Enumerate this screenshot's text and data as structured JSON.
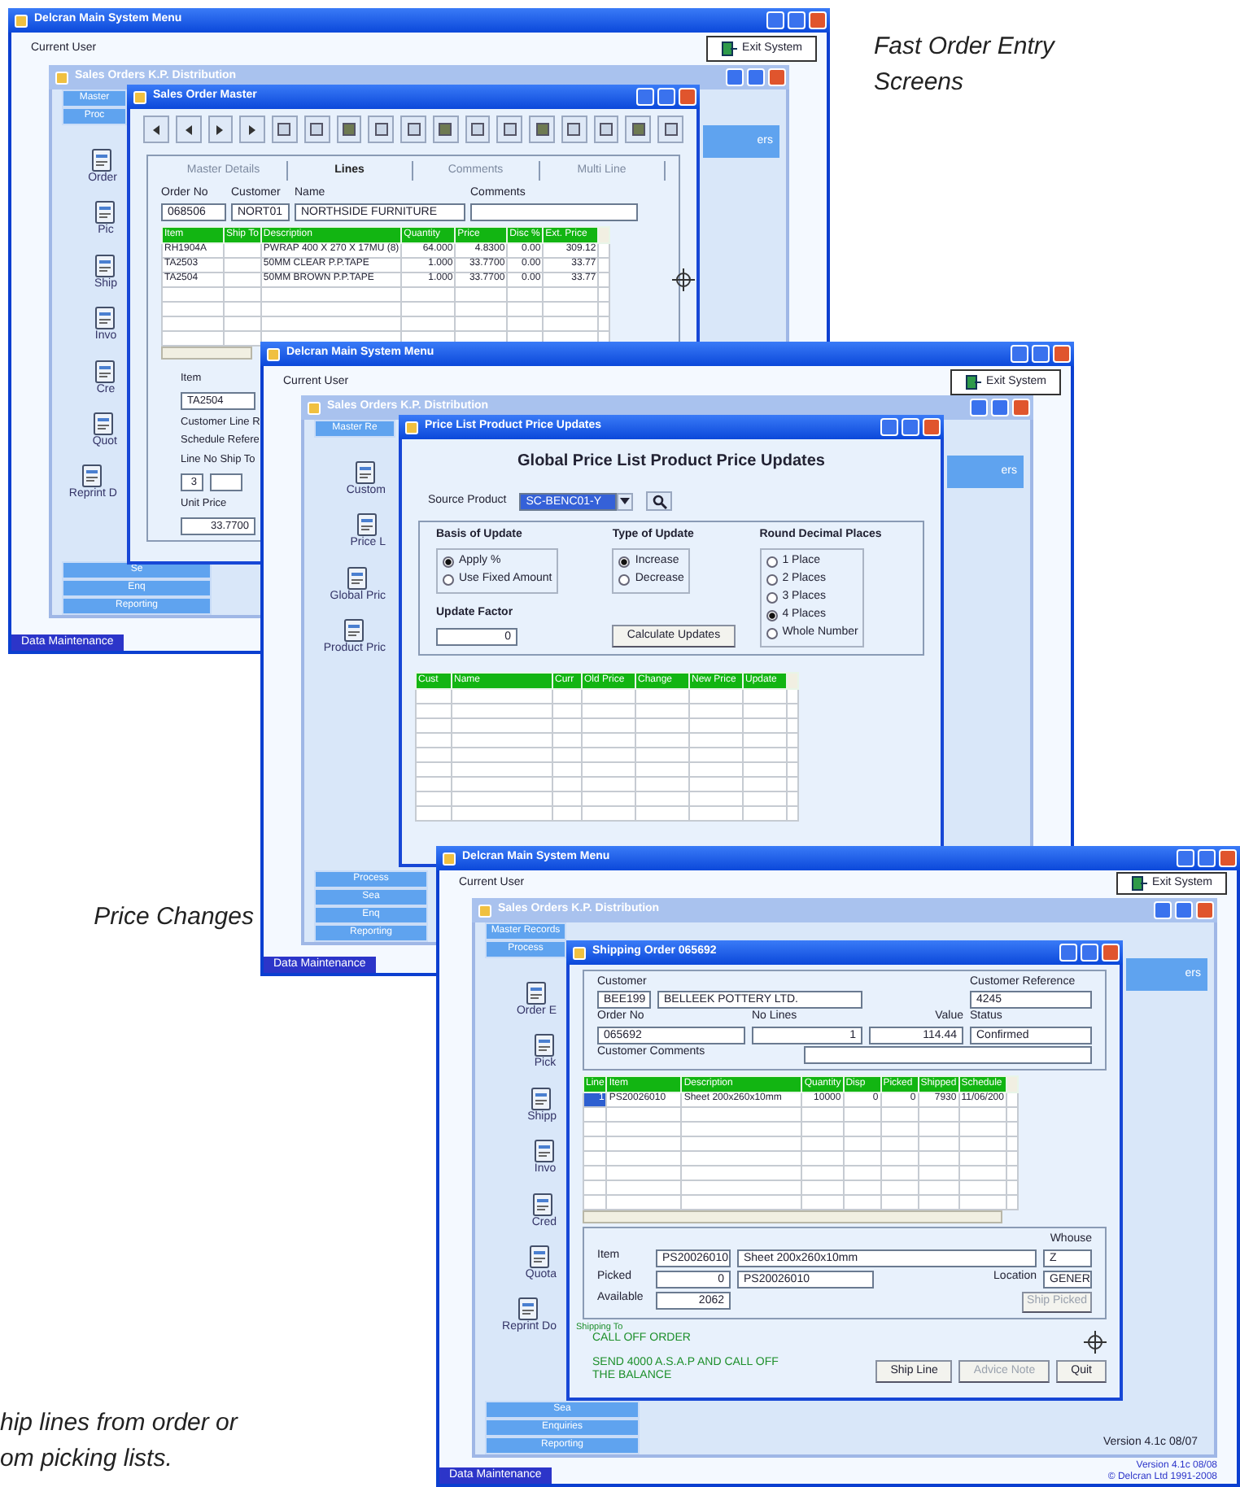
{
  "captions": [
    {
      "lines": [
        "Fast Order Entry",
        "Screens"
      ]
    },
    {
      "lines": [
        "Price Changes"
      ]
    },
    {
      "lines": [
        "hip lines from order or",
        "om picking lists."
      ]
    }
  ],
  "screens": [
    {
      "main": {
        "title": "Delcran Main System Menu",
        "user_label": "Current User",
        "exit_button": "Exit System",
        "bottom_tab": "Data Maintenance"
      },
      "sales": {
        "title": "Sales Orders K.P. Distribution",
        "tabs": [
          "Master",
          "Proc"
        ],
        "side_button": "ers",
        "icons": [
          "Order",
          "Pic",
          "Ship",
          "Invo",
          "Cre",
          "Quot",
          "Reprint D"
        ],
        "bottom_tabs": [
          "Se",
          "Enq",
          "Reporting"
        ]
      },
      "dialog": {
        "kind": "order_master",
        "title": "Sales Order Master",
        "tabs": [
          {
            "label": "Master Details",
            "selected": false
          },
          {
            "label": "Lines",
            "selected": true
          },
          {
            "label": "Comments",
            "selected": false
          },
          {
            "label": "Multi Line",
            "selected": false
          }
        ],
        "header_fields": [
          {
            "label": "Order No",
            "value": "068506"
          },
          {
            "label": "Customer",
            "value": "NORT01"
          },
          {
            "label": "Name",
            "value": "NORTHSIDE FURNITURE"
          },
          {
            "label": "Comments"
          }
        ],
        "grid": {
          "columns": [
            "Item",
            "Ship To",
            "Description",
            "Quantity",
            "Price",
            "Disc %",
            "Ext. Price"
          ],
          "rows": [
            [
              "RH1904A",
              "",
              "PWRAP 400 X 270 X 17MU (8)",
              "64.000",
              "4.8300",
              "0.00",
              "309.12"
            ],
            [
              "TA2503",
              "",
              "50MM CLEAR P.P.TAPE",
              "1.000",
              "33.7700",
              "0.00",
              "33.77"
            ],
            [
              "TA2504",
              "",
              "50MM BROWN P.P.TAPE",
              "1.000",
              "33.7700",
              "0.00",
              "33.77"
            ]
          ]
        },
        "lower": [
          {
            "kind": "label",
            "text": "Item"
          },
          {
            "kind": "field",
            "value": "TA2504"
          },
          {
            "kind": "label",
            "text": "Customer Line R"
          },
          {
            "kind": "label",
            "text": "Schedule Refere"
          },
          {
            "kind": "label",
            "text": "Line No Ship To"
          },
          {
            "kind": "fieldpair",
            "value": "3"
          },
          {
            "kind": "label",
            "text": "Unit Price"
          },
          {
            "kind": "field",
            "value": "33.7700"
          }
        ]
      }
    },
    {
      "main": {
        "title": "Delcran Main System Menu",
        "user_label": "Current User",
        "exit_button": "Exit System",
        "bottom_tab": "Data Maintenance"
      },
      "sales": {
        "title": "Sales Orders K.P. Distribution",
        "tabs": [
          "Master Re"
        ],
        "side_button": "ers",
        "icons": [
          "Custom",
          "Price L",
          "Global Pric",
          "Product Pric"
        ],
        "bottom_tabs": [
          "Process",
          "Sea",
          "Enq",
          "Reporting"
        ]
      },
      "dialog": {
        "kind": "price_update",
        "title": "Price List Product Price Updates",
        "heading": "Global Price List Product Price Updates",
        "source_label": "Source Product",
        "source_value": "SC-BENC01-Y",
        "groups": [
          {
            "title": "Basis of Update",
            "options": [
              {
                "label": "Apply %",
                "checked": true
              },
              {
                "label": "Use Fixed Amount",
                "checked": false
              }
            ]
          },
          {
            "title": "Type of Update",
            "options": [
              {
                "label": "Increase",
                "checked": true
              },
              {
                "label": "Decrease",
                "checked": false
              }
            ]
          },
          {
            "title": "Round Decimal Places",
            "options": [
              {
                "label": "1 Place",
                "checked": false
              },
              {
                "label": "2 Places",
                "checked": false
              },
              {
                "label": "3 Places",
                "checked": false
              },
              {
                "label": "4 Places",
                "checked": true
              },
              {
                "label": "Whole Number",
                "checked": false
              }
            ]
          }
        ],
        "factor_label": "Update Factor",
        "factor_value": "0",
        "calc_button": "Calculate Updates",
        "grid": {
          "columns": [
            "Cust",
            "Name",
            "Curr",
            "Old Price",
            "Change",
            "New Price",
            "Update"
          ]
        }
      }
    },
    {
      "main": {
        "title": "Delcran Main System Menu",
        "user_label": "Current User",
        "exit_button": "Exit System",
        "bottom_tab": "Data Maintenance",
        "version_lines": [
          "Version 4.1c 08/08",
          "© Delcran Ltd 1991-2008"
        ]
      },
      "sales": {
        "title": "Sales Orders K.P. Distribution",
        "tabs": [
          "Master Records",
          "Process"
        ],
        "side_button": "ers",
        "icons": [
          "Order E",
          "Pick",
          "Shipp",
          "Invo",
          "Cred",
          "Quota",
          "Reprint Do"
        ],
        "bottom_tabs": [
          "Sea",
          "Enquiries",
          "Reporting"
        ],
        "version": "Version 4.1c 08/07"
      },
      "dialog": {
        "kind": "shipping_order",
        "title": "Shipping Order 065692",
        "customer_label": "Customer",
        "customer_code": "BEE199",
        "customer_name": "BELLEEK POTTERY LTD.",
        "reference_label": "Customer Reference",
        "reference": "4245",
        "order_label": "Order No",
        "order_no": "065692",
        "lines_label": "No Lines",
        "lines": "1",
        "value_label": "Value",
        "value": "114.44",
        "status_label": "Status",
        "status": "Confirmed",
        "comments_label": "Customer Comments",
        "grid": {
          "columns": [
            "Line",
            "Item",
            "Description",
            "Quantity",
            "Disp",
            "Picked",
            "Shipped",
            "Schedule"
          ],
          "rows": [
            [
              "1",
              "PS20026010",
              "Sheet 200x260x10mm",
              "10000",
              "0",
              "0",
              "7930",
              "11/06/200"
            ]
          ]
        },
        "item_label": "Item",
        "item": "PS20026010",
        "item_desc": "Sheet 200x260x10mm",
        "whouse_label": "Whouse",
        "whouse": "Z",
        "picked_label": "Picked",
        "picked": "0",
        "picked_item": "PS20026010",
        "location_label": "Location",
        "location": "GENER",
        "available_label": "Available",
        "available": "2062",
        "shipping_label": "Shipping To",
        "notes": [
          "CALL OFF ORDER",
          "SEND 4000 A.S.A.P AND CALL OFF",
          "THE BALANCE"
        ],
        "buttons": [
          {
            "label": "Ship Picked",
            "disabled": true,
            "kind": "side"
          },
          {
            "label": "Ship Line",
            "disabled": false,
            "kind": "bottom"
          },
          {
            "label": "Advice Note",
            "disabled": true,
            "kind": "bottom"
          },
          {
            "label": "Quit",
            "disabled": false,
            "kind": "bottom"
          }
        ]
      }
    }
  ]
}
